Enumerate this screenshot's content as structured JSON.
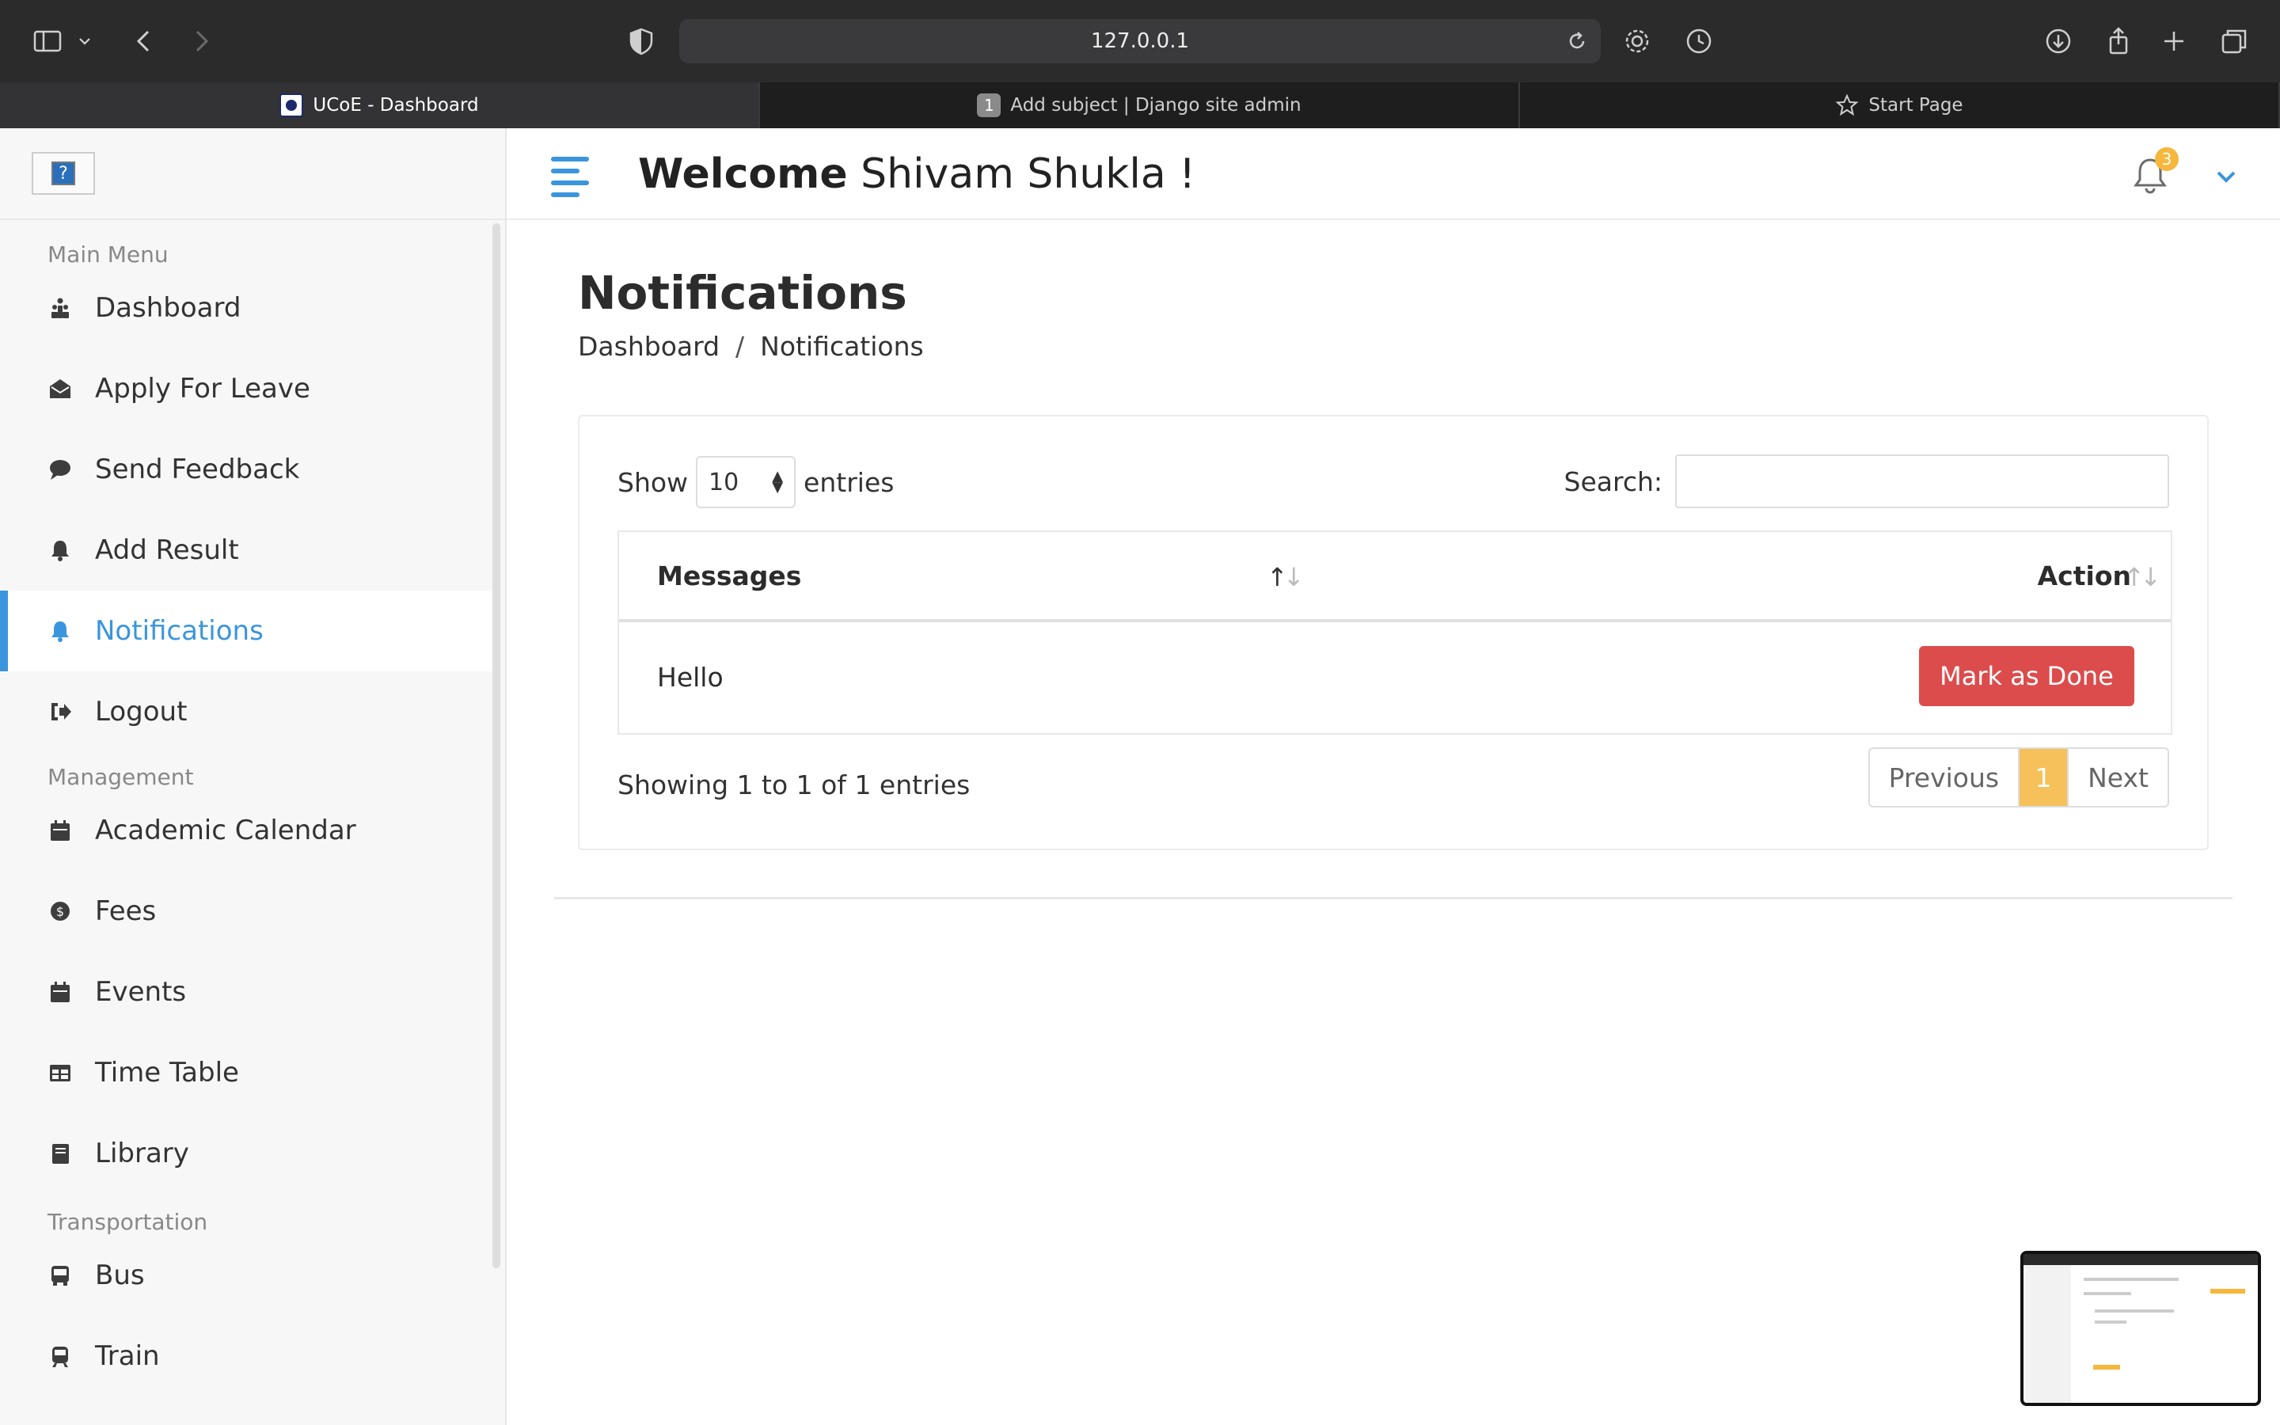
{
  "browser": {
    "url": "127.0.0.1",
    "tabs": [
      {
        "label": "UCoE - Dashboard",
        "active": true
      },
      {
        "label": "Add subject | Django site admin",
        "badge": "1",
        "active": false
      },
      {
        "label": "Start Page",
        "active": false
      }
    ]
  },
  "sidebar": {
    "sections": [
      {
        "title": "Main Menu",
        "items": [
          {
            "label": "Dashboard",
            "icon": "dashboard-icon"
          },
          {
            "label": "Apply For Leave",
            "icon": "envelope-open-icon"
          },
          {
            "label": "Send Feedback",
            "icon": "comment-icon"
          },
          {
            "label": "Add Result",
            "icon": "bell-icon"
          },
          {
            "label": "Notifications",
            "icon": "bell-icon",
            "active": true
          },
          {
            "label": "Logout",
            "icon": "sign-out-icon"
          }
        ]
      },
      {
        "title": "Management",
        "items": [
          {
            "label": "Academic Calendar",
            "icon": "calendar-icon"
          },
          {
            "label": "Fees",
            "icon": "money-icon"
          },
          {
            "label": "Events",
            "icon": "calendar-icon"
          },
          {
            "label": "Time Table",
            "icon": "table-icon"
          },
          {
            "label": "Library",
            "icon": "book-icon"
          }
        ]
      },
      {
        "title": "Transportation",
        "items": [
          {
            "label": "Bus",
            "icon": "bus-icon"
          },
          {
            "label": "Train",
            "icon": "train-icon"
          }
        ]
      }
    ]
  },
  "header": {
    "welcome_bold": "Welcome",
    "welcome_name": "Shivam Shukla  !",
    "notification_count": "3"
  },
  "page": {
    "title": "Notifications",
    "breadcrumb": [
      "Dashboard",
      "Notifications"
    ],
    "breadcrumb_sep": "/"
  },
  "table": {
    "show_label": "Show",
    "entries_value": "10",
    "entries_label": "entries",
    "search_label": "Search:",
    "columns": [
      "Messages",
      "Action"
    ],
    "rows": [
      {
        "message": "Hello",
        "action": "Mark as Done"
      }
    ],
    "info": "Showing 1 to 1 of 1 entries",
    "pager": {
      "previous": "Previous",
      "current": "1",
      "next": "Next"
    }
  },
  "colors": {
    "accent": "#3a95dd",
    "danger": "#dc4c4c",
    "warning": "#f6c15a"
  }
}
